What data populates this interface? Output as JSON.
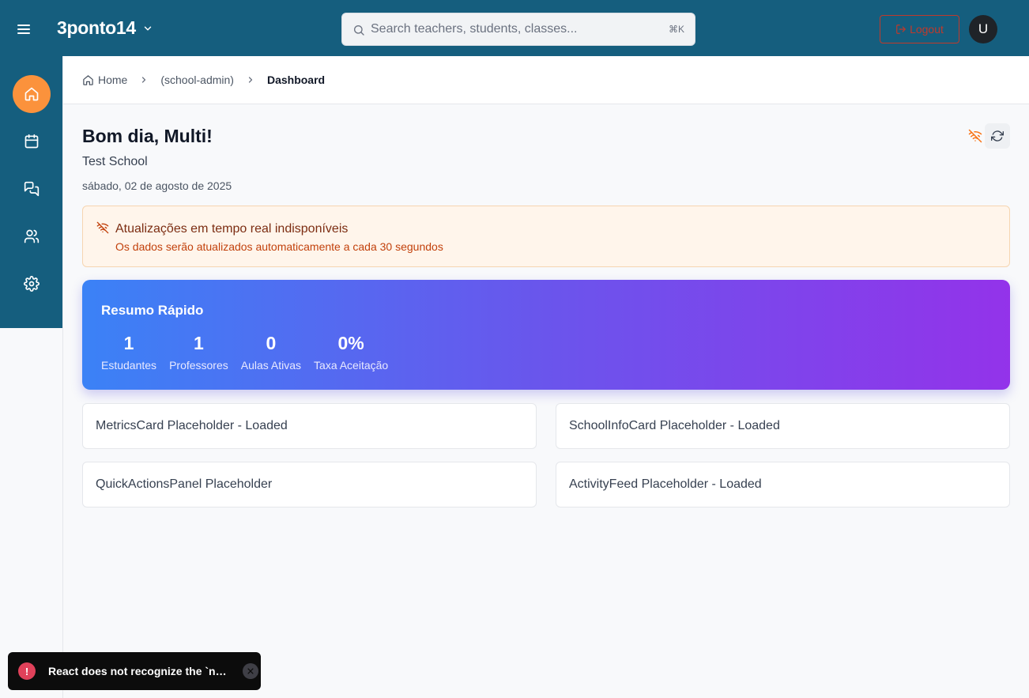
{
  "header": {
    "brand": "3ponto14",
    "search": {
      "placeholder": "Search teachers, students, classes...",
      "shortcut": "⌘K"
    },
    "logout_label": "Logout",
    "avatar_initial": "U"
  },
  "sidebar": {
    "items": [
      {
        "icon": "home-icon",
        "active": true
      },
      {
        "icon": "calendar-icon",
        "active": false
      },
      {
        "icon": "chat-icon",
        "active": false
      },
      {
        "icon": "users-icon",
        "active": false
      },
      {
        "icon": "settings-icon",
        "active": false
      }
    ]
  },
  "breadcrumb": {
    "home": "Home",
    "section": "(school-admin)",
    "current": "Dashboard"
  },
  "page": {
    "greeting": "Bom dia, Multi!",
    "school": "Test School",
    "date": "sábado, 02 de agosto de 2025"
  },
  "alert": {
    "title": "Atualizações em tempo real indisponíveis",
    "message": "Os dados serão atualizados automaticamente a cada 30 segundos"
  },
  "summary": {
    "title": "Resumo Rápido",
    "stats": [
      {
        "value": "1",
        "label": "Estudantes"
      },
      {
        "value": "1",
        "label": "Professores"
      },
      {
        "value": "0",
        "label": "Aulas Ativas"
      },
      {
        "value": "0%",
        "label": "Taxa Aceitação"
      }
    ]
  },
  "cards": [
    "MetricsCard Placeholder - Loaded",
    "SchoolInfoCard Placeholder - Loaded",
    "QuickActionsPanel Placeholder",
    "ActivityFeed Placeholder - Loaded"
  ],
  "toast": {
    "message": "React does not recognize the `nullValue` prop on a DOM element."
  },
  "colors": {
    "topbar": "#155e7e",
    "active_nav": "#fb923c",
    "logout": "#c0392b",
    "alert_bg": "#fff5eb",
    "gradient_start": "#3b82f6",
    "gradient_end": "#9333ea"
  }
}
